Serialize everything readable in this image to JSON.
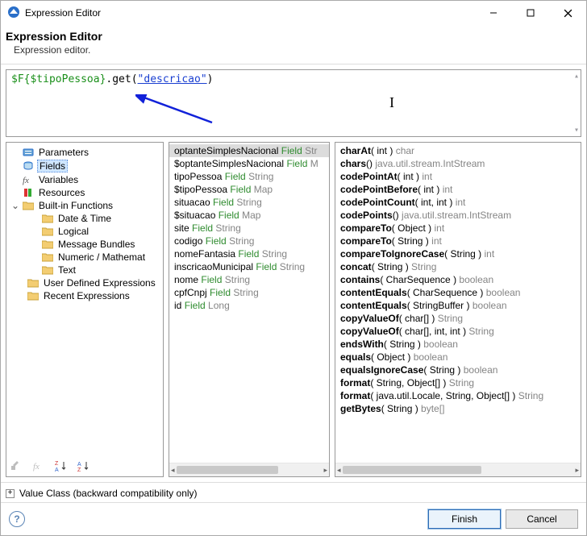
{
  "window": {
    "title": "Expression Editor"
  },
  "header": {
    "title": "Expression Editor",
    "subtitle": "Expression editor."
  },
  "expression": {
    "prefix": "$F{$tipoPessoa}",
    "method": ".get(",
    "string": "\"descricao\"",
    "close": ")"
  },
  "tree": {
    "parameters": "Parameters",
    "fields": "Fields",
    "variables": "Variables",
    "resources": "Resources",
    "builtins": "Built-in Functions",
    "datetime": "Date & Time",
    "logical": "Logical",
    "msgbundles": "Message Bundles",
    "numeric": "Numeric / Mathemat",
    "text": "Text",
    "userdef": "User Defined Expressions",
    "recent": "Recent Expressions"
  },
  "fields": [
    {
      "name": "optanteSimplesNacional",
      "kind": "Field",
      "type": "Str",
      "sel": true
    },
    {
      "name": "$optanteSimplesNacional",
      "kind": "Field",
      "type": "M"
    },
    {
      "name": "tipoPessoa",
      "kind": "Field",
      "type": "String"
    },
    {
      "name": "$tipoPessoa",
      "kind": "Field",
      "type": "Map"
    },
    {
      "name": "situacao",
      "kind": "Field",
      "type": "String"
    },
    {
      "name": "$situacao",
      "kind": "Field",
      "type": "Map"
    },
    {
      "name": "site",
      "kind": "Field",
      "type": "String"
    },
    {
      "name": "codigo",
      "kind": "Field",
      "type": "String"
    },
    {
      "name": "nomeFantasia",
      "kind": "Field",
      "type": "String"
    },
    {
      "name": "inscricaoMunicipal",
      "kind": "Field",
      "type": "String"
    },
    {
      "name": "nome",
      "kind": "Field",
      "type": "String"
    },
    {
      "name": "cpfCnpj",
      "kind": "Field",
      "type": "String"
    },
    {
      "name": "id",
      "kind": "Field",
      "type": "Long"
    }
  ],
  "methods": [
    {
      "name": "charAt",
      "sig": "( int )",
      "ret": "char"
    },
    {
      "name": "chars",
      "sig": "()",
      "ret": "java.util.stream.IntStream"
    },
    {
      "name": "codePointAt",
      "sig": "( int )",
      "ret": "int"
    },
    {
      "name": "codePointBefore",
      "sig": "( int )",
      "ret": "int"
    },
    {
      "name": "codePointCount",
      "sig": "( int, int )",
      "ret": "int"
    },
    {
      "name": "codePoints",
      "sig": "()",
      "ret": "java.util.stream.IntStream"
    },
    {
      "name": "compareTo",
      "sig": "( Object )",
      "ret": "int"
    },
    {
      "name": "compareTo",
      "sig": "( String )",
      "ret": "int"
    },
    {
      "name": "compareToIgnoreCase",
      "sig": "( String )",
      "ret": "int"
    },
    {
      "name": "concat",
      "sig": "( String )",
      "ret": "String"
    },
    {
      "name": "contains",
      "sig": "( CharSequence )",
      "ret": "boolean"
    },
    {
      "name": "contentEquals",
      "sig": "( CharSequence )",
      "ret": "boolean"
    },
    {
      "name": "contentEquals",
      "sig": "( StringBuffer )",
      "ret": "boolean"
    },
    {
      "name": "copyValueOf",
      "sig": "( char[] )",
      "ret": "String"
    },
    {
      "name": "copyValueOf",
      "sig": "( char[], int, int )",
      "ret": "String"
    },
    {
      "name": "endsWith",
      "sig": "( String )",
      "ret": "boolean"
    },
    {
      "name": "equals",
      "sig": "( Object )",
      "ret": "boolean"
    },
    {
      "name": "equalsIgnoreCase",
      "sig": "( String )",
      "ret": "boolean"
    },
    {
      "name": "format",
      "sig": "( String, Object[] )",
      "ret": "String"
    },
    {
      "name": "format",
      "sig": "( java.util.Locale, String, Object[] )",
      "ret": "String"
    },
    {
      "name": "getBytes",
      "sig": "( String )",
      "ret": "byte[]"
    }
  ],
  "collapsible": {
    "label": "Value Class (backward compatibility only)"
  },
  "footer": {
    "finish": "Finish",
    "cancel": "Cancel"
  }
}
